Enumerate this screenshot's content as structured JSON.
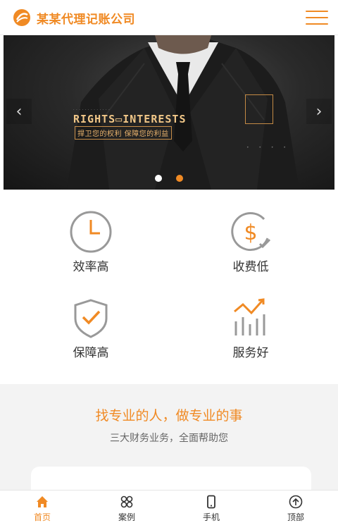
{
  "header": {
    "logo_text": "某某代理记账公司",
    "menu_icon": "hamburger-menu-icon"
  },
  "banner": {
    "title": "RIGHTS▭INTERESTS",
    "subtitle": "捍卫您的权利 保障您的利益",
    "slides": 2,
    "active_slide": 2,
    "prev_icon": "chevron-left-icon",
    "next_icon": "chevron-right-icon"
  },
  "features": [
    {
      "label": "效率高",
      "icon": "clock-icon"
    },
    {
      "label": "收费低",
      "icon": "dollar-icon"
    },
    {
      "label": "保障高",
      "icon": "shield-check-icon"
    },
    {
      "label": "服务好",
      "icon": "trend-chart-icon"
    }
  ],
  "section": {
    "slogan": "找专业的人，做专业的事",
    "subtitle": "三大财务业务，全面帮助您"
  },
  "bottom_nav": [
    {
      "label": "首页",
      "icon": "home-icon",
      "active": true
    },
    {
      "label": "案例",
      "icon": "grid-icon",
      "active": false
    },
    {
      "label": "手机",
      "icon": "phone-icon",
      "active": false
    },
    {
      "label": "顶部",
      "icon": "arrow-up-circle-icon",
      "active": false
    }
  ],
  "colors": {
    "accent": "#f08a24",
    "dot_inactive": "#ffffff",
    "dot_active": "#f08a24",
    "icon_gray": "#888888"
  }
}
